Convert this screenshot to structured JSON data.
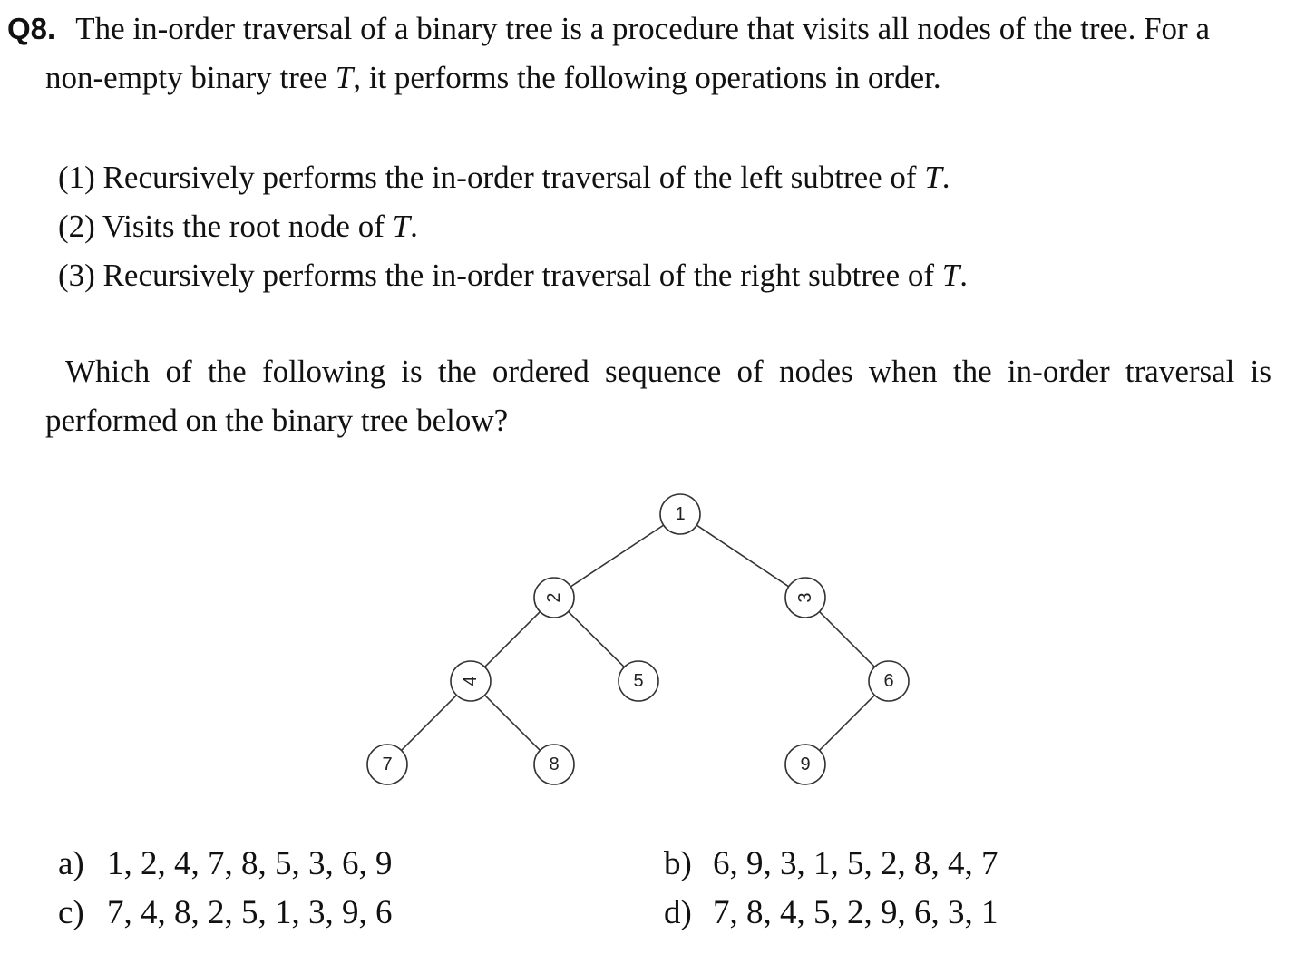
{
  "question": {
    "number": "Q8.",
    "intro_line1": "The in-order traversal of a binary tree is a procedure that visits all nodes of the tree. For a",
    "intro_line2_a": "non-empty binary tree ",
    "intro_line2_var": "T",
    "intro_line2_b": ", it performs the following operations in order.",
    "steps": [
      {
        "text": "(1) Recursively performs the in-order traversal of the left subtree of ",
        "var": "T",
        "end": "."
      },
      {
        "text": "(2) Visits the root node of ",
        "var": "T",
        "end": "."
      },
      {
        "text": "(3) Recursively performs the in-order traversal of the right subtree of ",
        "var": "T",
        "end": "."
      }
    ],
    "prompt_line1": "Which of the following is the ordered sequence of nodes when the in-order traversal is",
    "prompt_line2": "performed on the binary tree below?"
  },
  "tree": {
    "nodes": [
      {
        "id": "1",
        "label": "1",
        "rotate": 0
      },
      {
        "id": "2",
        "label": "2",
        "rotate": -90
      },
      {
        "id": "3",
        "label": "3",
        "rotate": -90
      },
      {
        "id": "4",
        "label": "4",
        "rotate": -90
      },
      {
        "id": "5",
        "label": "5",
        "rotate": 0
      },
      {
        "id": "6",
        "label": "6",
        "rotate": 0
      },
      {
        "id": "7",
        "label": "7",
        "rotate": 0
      },
      {
        "id": "8",
        "label": "8",
        "rotate": 0
      },
      {
        "id": "9",
        "label": "9",
        "rotate": 0
      }
    ],
    "edges": [
      [
        "1",
        "2"
      ],
      [
        "1",
        "3"
      ],
      [
        "2",
        "4"
      ],
      [
        "2",
        "5"
      ],
      [
        "3",
        "6"
      ],
      [
        "4",
        "7"
      ],
      [
        "4",
        "8"
      ],
      [
        "6",
        "9"
      ]
    ]
  },
  "options": [
    {
      "label": "a)",
      "value": "1, 2, 4, 7, 8, 5, 3, 6, 9"
    },
    {
      "label": "b)",
      "value": "6, 9, 3, 1, 5, 2, 8, 4, 7"
    },
    {
      "label": "c)",
      "value": "7, 4, 8, 2, 5, 1, 3, 9, 6"
    },
    {
      "label": "d)",
      "value": "7, 8, 4, 5, 2, 9, 6, 3, 1"
    }
  ]
}
